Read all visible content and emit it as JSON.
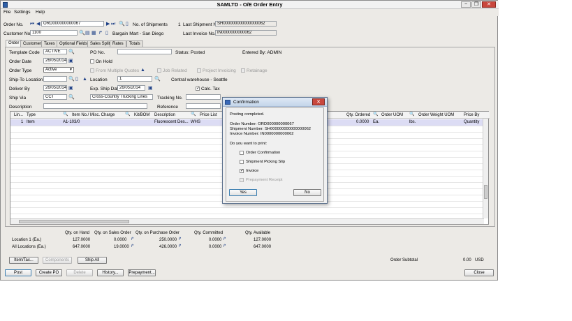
{
  "window": {
    "title": "SAMLTD - O/E Order Entry",
    "minimize": "−",
    "restore": "❐",
    "close": "✕"
  },
  "menu": {
    "file": "File",
    "settings": "Settings",
    "help": "Help"
  },
  "header": {
    "order_no_label": "Order No.",
    "order_no": "ORD000000000067",
    "num_shipments_label": "No. of Shipments",
    "num_shipments": "1",
    "last_shipment_label": "Last Shipment No.",
    "last_shipment": "SH000000000000000062",
    "customer_no_label": "Customer No.",
    "customer_no": "1100",
    "customer_name": "Bargain Mart - San Diego",
    "last_invoice_label": "Last Invoice No.",
    "last_invoice": "IN0000000000062"
  },
  "tabs": [
    "Order",
    "Customer",
    "Taxes",
    "Optional Fields",
    "Sales Split",
    "Rates",
    "Totals"
  ],
  "form": {
    "template_code_label": "Template Code",
    "template_code": "ACTIVE",
    "po_no_label": "PO No.",
    "po_no": "",
    "status": "Status: Posted",
    "entered_by": "Entered By: ADMIN",
    "order_date_label": "Order Date",
    "order_date": "26/05/2014",
    "on_hold_label": "On Hold",
    "order_type_label": "Order Type",
    "order_type": "Active",
    "from_multiple_quotes_label": "From Multiple Quotes",
    "job_related_label": "Job Related",
    "project_invoicing_label": "Project Invoicing",
    "retainage_label": "Retainage",
    "ship_to_location_label": "Ship-To Location",
    "ship_to_location": "",
    "location_label": "Location",
    "location": "1",
    "location_name": "Central warehouse - Seattle",
    "deliver_by_label": "Deliver By",
    "deliver_by": "26/05/2014",
    "exp_ship_date_label": "Exp. Ship Date",
    "exp_ship_date": "26/05/2014",
    "calc_tax_label": "Calc. Tax",
    "ship_via_label": "Ship Via",
    "ship_via": "CCT",
    "ship_via_name": "Cross-Country Trucking Lines",
    "tracking_no_label": "Tracking No.",
    "tracking_no": "",
    "description_label": "Description",
    "description": "",
    "reference_label": "Reference",
    "reference": ""
  },
  "grid": {
    "columns": [
      "Lin...",
      "Type",
      "Item No./ Misc. Charge",
      "Kit/BOM",
      "Description",
      "Price List",
      "Qty. Ordered",
      "Order UOM",
      "Order Weight UOM",
      "Price By"
    ],
    "rows": [
      {
        "line": "1",
        "type": "Item",
        "item": "A1-103/0",
        "kit": "",
        "description": "Fluorescent Des...",
        "price_list": "WHS",
        "qty_ordered": "0.0000",
        "order_uom": "Ea.",
        "weight_uom": "lbs.",
        "price_by": "Quantity"
      }
    ]
  },
  "summary": {
    "headers": [
      "Qty. on Hand",
      "Qty. on Sales Order",
      "Qty. on Purchase Order",
      "Qty. Committed",
      "Qty. Available"
    ],
    "rows": [
      {
        "label": "Location  1 (Ea.)",
        "values": [
          "127.0000",
          "0.0000",
          "250.0000",
          "0.0000",
          "127.0000"
        ]
      },
      {
        "label": "All Locations (Ea.)",
        "values": [
          "647.0000",
          "19.0000",
          "426.0000",
          "0.0000",
          "647.0000"
        ]
      }
    ],
    "order_subtotal_label": "Order Subtotal",
    "order_subtotal": "0.00",
    "currency": "USD"
  },
  "buttons": {
    "item_tax": "Item/Tax...",
    "components": "Components",
    "ship_all": "Ship All",
    "post": "Post",
    "create_po": "Create PO",
    "delete": "Delete",
    "history": "History...",
    "prepayment": "Prepayment...",
    "close": "Close"
  },
  "dialog": {
    "title": "Confirmation",
    "message": "Posting completed.",
    "order_number": "Order Number: ORD000000000067",
    "shipment_number": "Shipment Number: SH000000000000000062",
    "invoice_number": "Invoice Number: IN0000000000062",
    "question": "Do you want to print:",
    "options": [
      {
        "label": "Order Confirmation",
        "checked": false,
        "enabled": true
      },
      {
        "label": "Shipment Picking Slip",
        "checked": false,
        "enabled": true
      },
      {
        "label": "Invoice",
        "checked": true,
        "enabled": true
      },
      {
        "label": "Prepayment Receipt",
        "checked": false,
        "enabled": false
      }
    ],
    "yes": "Yes",
    "no": "No"
  },
  "colors": {
    "selected_row": "#dcdcf4",
    "dialog_title": "#c4d5ea",
    "close_red": "#c9473d"
  }
}
